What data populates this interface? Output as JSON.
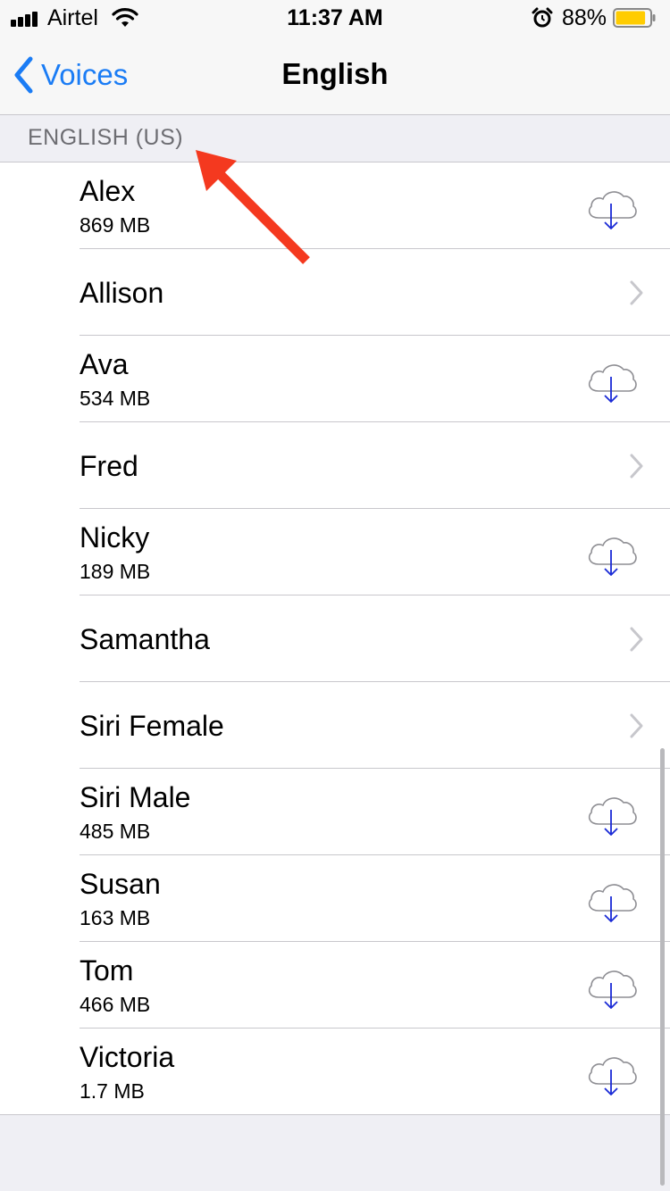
{
  "status_bar": {
    "carrier": "Airtel",
    "time": "11:37 AM",
    "battery_percent": "88%",
    "battery_level": 0.88,
    "battery_color": "#ffcc00"
  },
  "nav": {
    "back_label": "Voices",
    "title": "English"
  },
  "section": {
    "header": "ENGLISH (US)"
  },
  "voices": [
    {
      "name": "Alex",
      "size": "869 MB",
      "action": "download"
    },
    {
      "name": "Allison",
      "size": "",
      "action": "chevron"
    },
    {
      "name": "Ava",
      "size": "534 MB",
      "action": "download"
    },
    {
      "name": "Fred",
      "size": "",
      "action": "chevron"
    },
    {
      "name": "Nicky",
      "size": "189 MB",
      "action": "download"
    },
    {
      "name": "Samantha",
      "size": "",
      "action": "chevron"
    },
    {
      "name": "Siri Female",
      "size": "",
      "action": "chevron"
    },
    {
      "name": "Siri Male",
      "size": "485 MB",
      "action": "download"
    },
    {
      "name": "Susan",
      "size": "163 MB",
      "action": "download"
    },
    {
      "name": "Tom",
      "size": "466 MB",
      "action": "download"
    },
    {
      "name": "Victoria",
      "size": "1.7 MB",
      "action": "download"
    }
  ],
  "colors": {
    "accent": "#1a7cf5",
    "download_arrow": "#1a2ad6",
    "annotation": "#f4391f"
  }
}
